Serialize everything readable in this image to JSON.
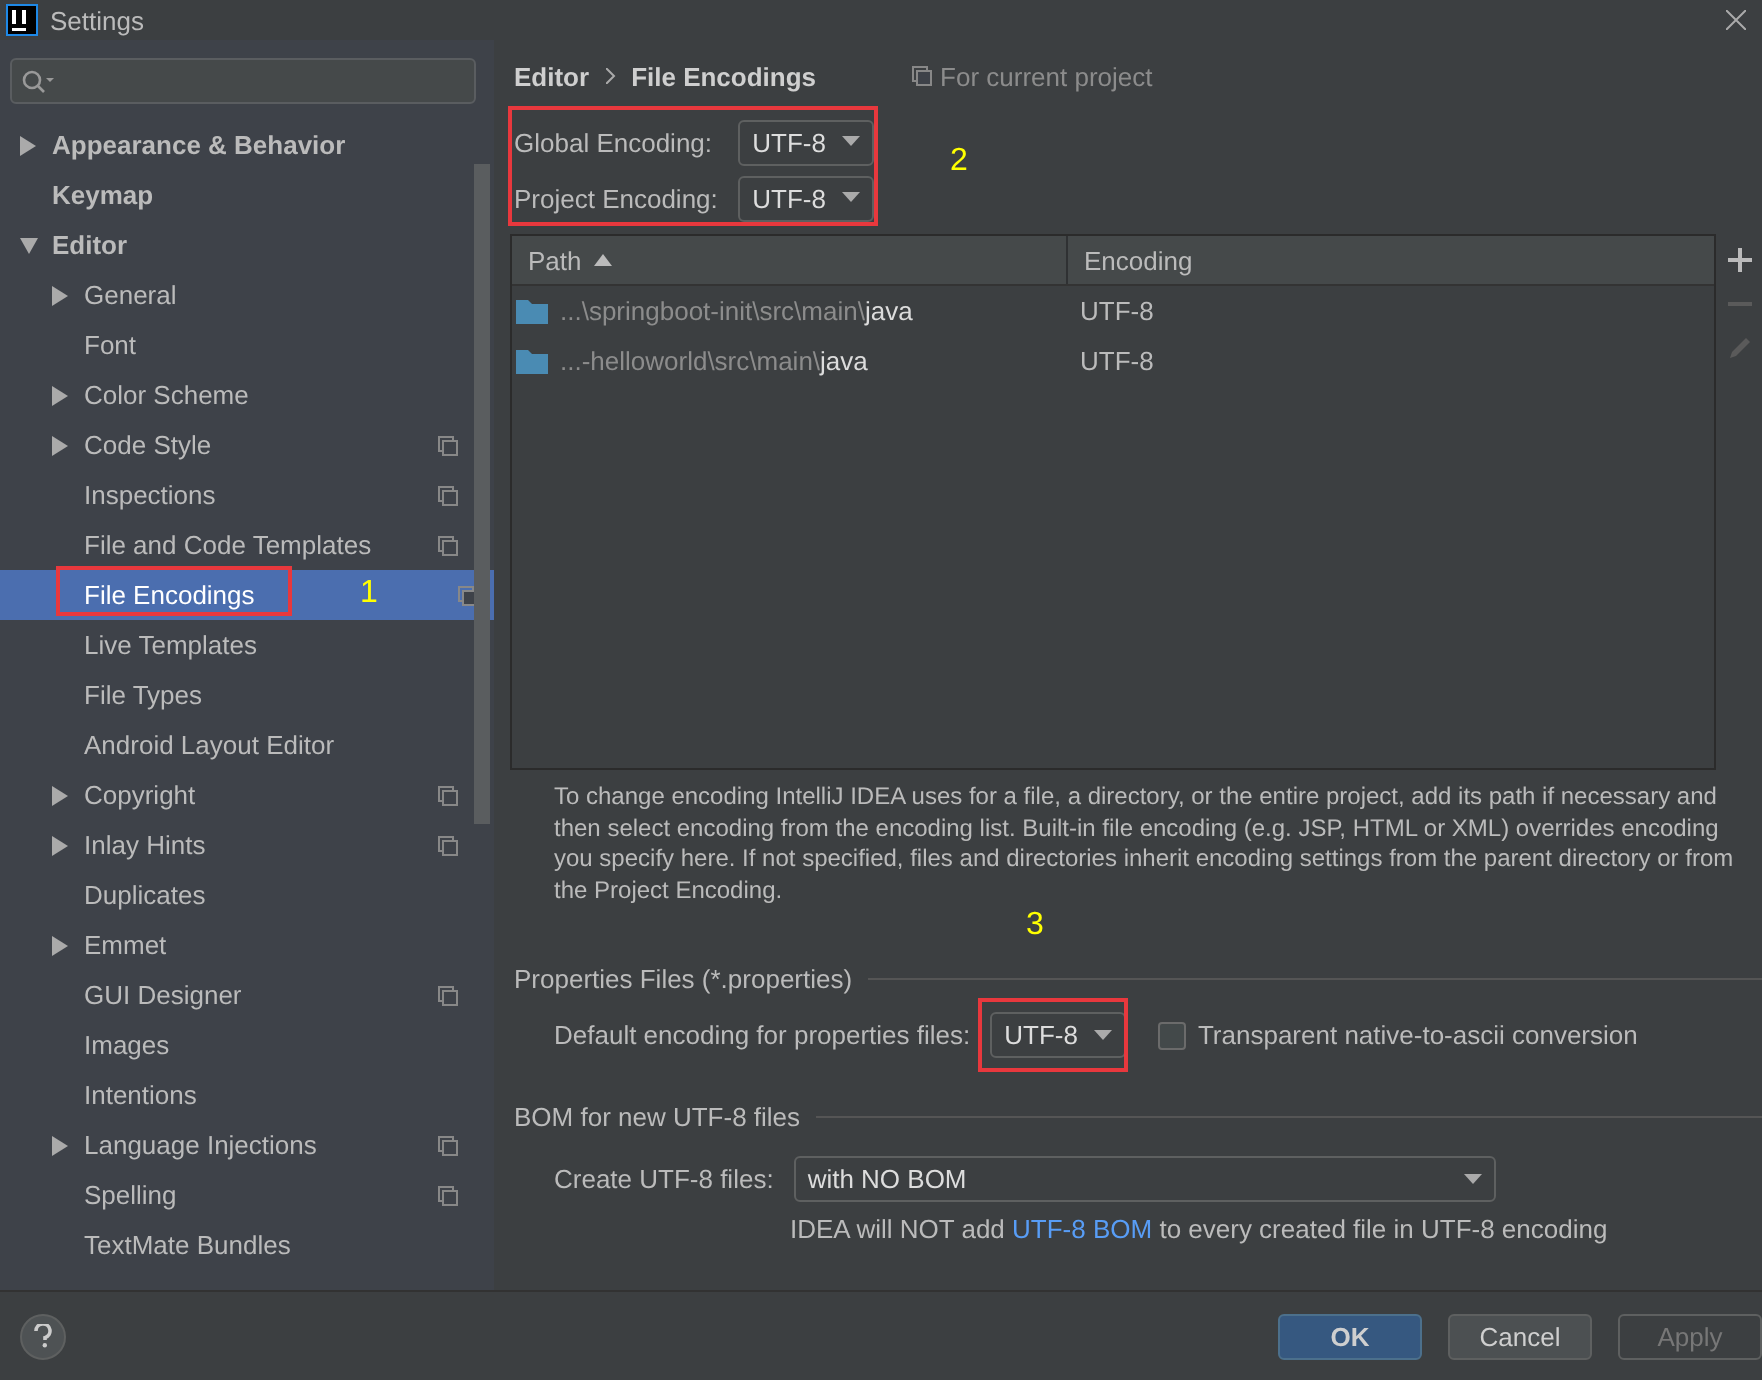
{
  "window": {
    "title": "Settings"
  },
  "sidebar": {
    "items": [
      {
        "label": "Appearance & Behavior",
        "expandable": true,
        "expanded": false,
        "selected": false,
        "project_icon": false
      },
      {
        "label": "Keymap",
        "expandable": false,
        "expanded": false,
        "selected": false,
        "project_icon": false
      },
      {
        "label": "Editor",
        "expandable": true,
        "expanded": true,
        "selected": false,
        "project_icon": false,
        "children": [
          {
            "label": "General",
            "expandable": true,
            "expanded": false,
            "selected": false,
            "project_icon": false
          },
          {
            "label": "Font",
            "expandable": false,
            "expanded": false,
            "selected": false,
            "project_icon": false
          },
          {
            "label": "Color Scheme",
            "expandable": true,
            "expanded": false,
            "selected": false,
            "project_icon": false
          },
          {
            "label": "Code Style",
            "expandable": true,
            "expanded": false,
            "selected": false,
            "project_icon": true
          },
          {
            "label": "Inspections",
            "expandable": false,
            "expanded": false,
            "selected": false,
            "project_icon": true
          },
          {
            "label": "File and Code Templates",
            "expandable": false,
            "expanded": false,
            "selected": false,
            "project_icon": true
          },
          {
            "label": "File Encodings",
            "expandable": false,
            "expanded": false,
            "selected": true,
            "project_icon": true,
            "annotation": "1"
          },
          {
            "label": "Live Templates",
            "expandable": false,
            "expanded": false,
            "selected": false,
            "project_icon": false
          },
          {
            "label": "File Types",
            "expandable": false,
            "expanded": false,
            "selected": false,
            "project_icon": false
          },
          {
            "label": "Android Layout Editor",
            "expandable": false,
            "expanded": false,
            "selected": false,
            "project_icon": false
          },
          {
            "label": "Copyright",
            "expandable": true,
            "expanded": false,
            "selected": false,
            "project_icon": true
          },
          {
            "label": "Inlay Hints",
            "expandable": true,
            "expanded": false,
            "selected": false,
            "project_icon": true
          },
          {
            "label": "Duplicates",
            "expandable": false,
            "expanded": false,
            "selected": false,
            "project_icon": false
          },
          {
            "label": "Emmet",
            "expandable": true,
            "expanded": false,
            "selected": false,
            "project_icon": false
          },
          {
            "label": "GUI Designer",
            "expandable": false,
            "expanded": false,
            "selected": false,
            "project_icon": true
          },
          {
            "label": "Images",
            "expandable": false,
            "expanded": false,
            "selected": false,
            "project_icon": false
          },
          {
            "label": "Intentions",
            "expandable": false,
            "expanded": false,
            "selected": false,
            "project_icon": false
          },
          {
            "label": "Language Injections",
            "expandable": true,
            "expanded": false,
            "selected": false,
            "project_icon": true
          },
          {
            "label": "Spelling",
            "expandable": false,
            "expanded": false,
            "selected": false,
            "project_icon": true
          },
          {
            "label": "TextMate Bundles",
            "expandable": false,
            "expanded": false,
            "selected": false,
            "project_icon": false
          }
        ]
      }
    ]
  },
  "breadcrumb": [
    "Editor",
    "File Encodings"
  ],
  "scope": "For current project",
  "encodings": {
    "annotation": "2",
    "rows": [
      {
        "label": "Global Encoding:",
        "value": "UTF-8"
      },
      {
        "label": "Project Encoding:",
        "value": "UTF-8"
      }
    ]
  },
  "table": {
    "columns": [
      {
        "label": "Path",
        "sorted": true
      },
      {
        "label": "Encoding",
        "sorted": false
      }
    ],
    "rows": [
      {
        "path_prefix": "...\\springboot-init\\src\\main\\",
        "path_name": "java",
        "encoding": "UTF-8"
      },
      {
        "path_prefix": "...-helloworld\\src\\main\\",
        "path_name": "java",
        "encoding": "UTF-8"
      }
    ],
    "toolbar": [
      {
        "kind": "add",
        "disabled": false
      },
      {
        "kind": "remove",
        "disabled": true
      },
      {
        "kind": "edit",
        "disabled": true
      }
    ]
  },
  "description": "To change encoding IntelliJ IDEA uses for a file, a directory, or the entire project, add its path if necessary and then select encoding from the encoding list. Built-in file encoding (e.g. JSP, HTML or XML) overrides encoding you specify here. If not specified, files and directories inherit encoding settings from the parent directory or from the Project Encoding.",
  "properties": {
    "title": "Properties Files (*.properties)",
    "label": "Default encoding for properties files:",
    "value": "UTF-8",
    "annotation": "3",
    "checkbox": {
      "label": "Transparent native-to-ascii conversion",
      "checked": false
    }
  },
  "bom": {
    "title": "BOM for new UTF-8 files",
    "label": "Create UTF-8 files:",
    "value": "with NO BOM",
    "note_before": "IDEA will NOT add ",
    "note_link": "UTF-8 BOM",
    "note_after": " to every created file in UTF-8 encoding"
  },
  "buttons": [
    {
      "label": "OK",
      "kind": "primary",
      "disabled": false
    },
    {
      "label": "Cancel",
      "kind": "normal",
      "disabled": false
    },
    {
      "label": "Apply",
      "kind": "normal",
      "disabled": true
    }
  ]
}
